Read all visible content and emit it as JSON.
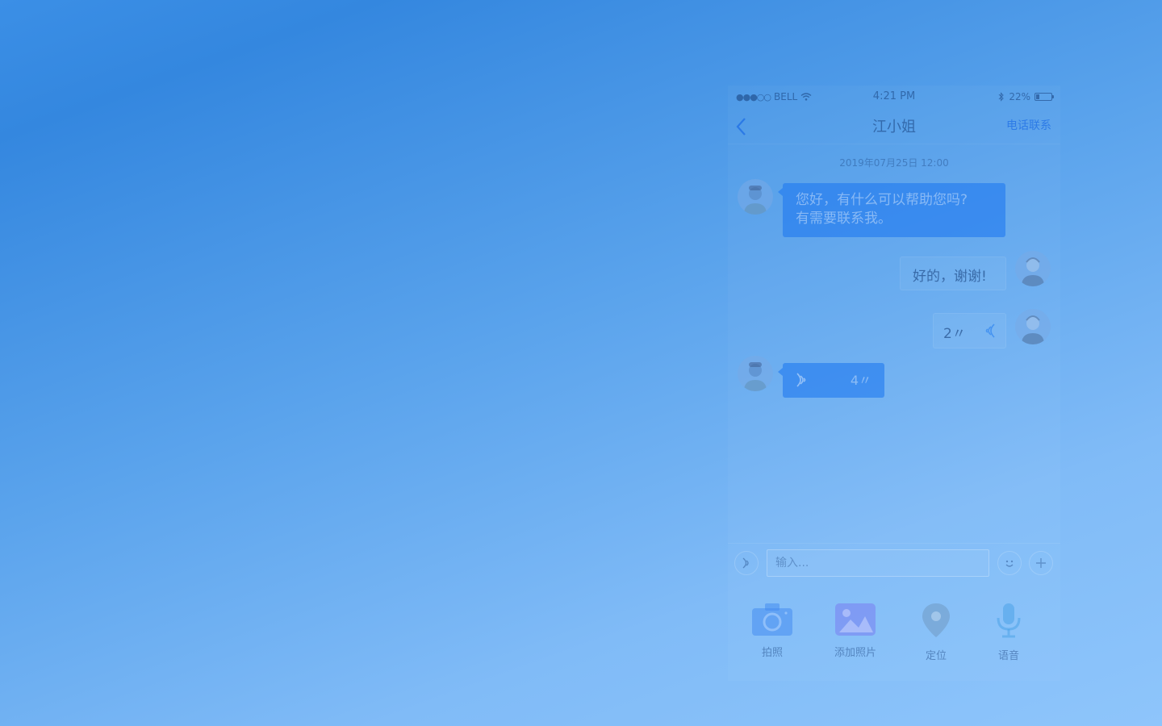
{
  "status_bar": {
    "signal_dots": "●●●○○",
    "carrier": "BELL",
    "time": "4:21 PM",
    "battery_percent": "22%",
    "battery_level": 0.22,
    "icons": [
      "wifi-icon",
      "bluetooth-icon",
      "battery-icon"
    ]
  },
  "nav": {
    "title": "江小姐",
    "action_label": "电话联系",
    "back_icon": "chevron-left-icon"
  },
  "chat": {
    "timestamp": "2019年07月25日 12:00",
    "messages": [
      {
        "from": "agent",
        "type": "text",
        "line1": "您好，有什么可以帮助您吗?",
        "line2": "有需要联系我。"
      },
      {
        "from": "me",
        "type": "text",
        "text": "好的，谢谢!"
      },
      {
        "from": "me",
        "type": "voice",
        "duration": "2〃"
      },
      {
        "from": "agent",
        "type": "voice",
        "duration": "4〃"
      }
    ]
  },
  "input": {
    "placeholder": "输入...",
    "value": ""
  },
  "tools": [
    {
      "label": "拍照",
      "icon": "camera-icon"
    },
    {
      "label": "添加照片",
      "icon": "photo-icon"
    },
    {
      "label": "定位",
      "icon": "location-pin-icon"
    },
    {
      "label": "语音",
      "icon": "microphone-icon"
    }
  ],
  "colors": {
    "background_start": "#3487df",
    "background_end": "#8ec5fb",
    "accent": "#1e78f0"
  }
}
